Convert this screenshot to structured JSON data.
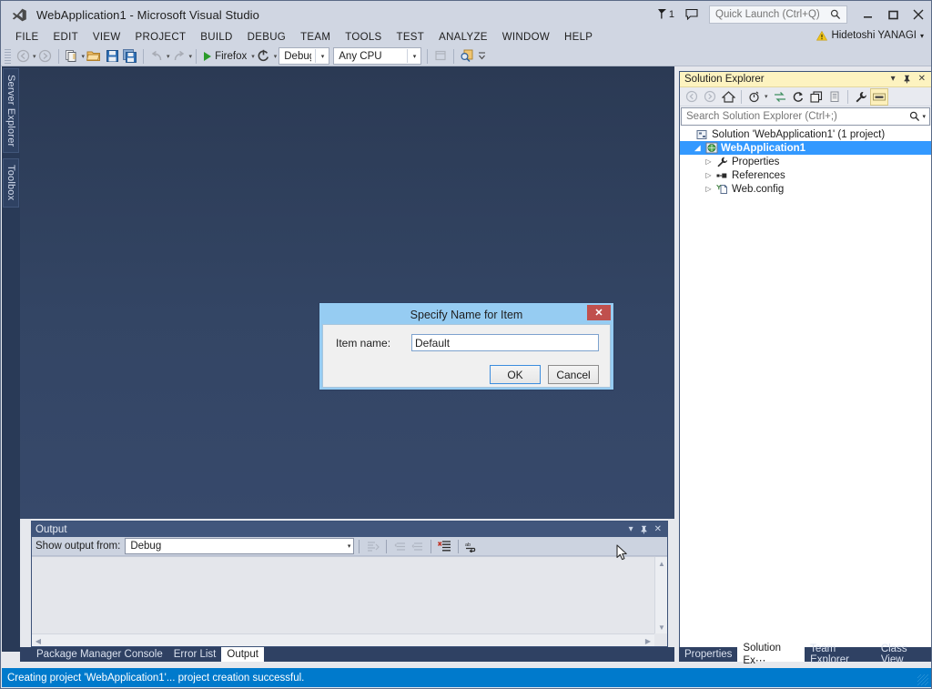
{
  "window": {
    "title": "WebApplication1 - Microsoft Visual Studio",
    "logo_icon": "visual-studio-logo-icon",
    "minimize_label": "–",
    "maximize_label": "❐",
    "close_label": "✕"
  },
  "titlebar": {
    "notification_icon": "notification-flag-icon",
    "notification_count": "1",
    "feedback_icon": "feedback-speech-bubble-icon",
    "quick_launch": {
      "placeholder": "Quick Launch (Ctrl+Q)",
      "value": "",
      "icon": "search-magnifier-icon"
    }
  },
  "menubar": {
    "items": [
      {
        "label": "FILE"
      },
      {
        "label": "EDIT"
      },
      {
        "label": "VIEW"
      },
      {
        "label": "PROJECT"
      },
      {
        "label": "BUILD"
      },
      {
        "label": "DEBUG"
      },
      {
        "label": "TEAM"
      },
      {
        "label": "TOOLS"
      },
      {
        "label": "TEST"
      },
      {
        "label": "ANALYZE"
      },
      {
        "label": "WINDOW"
      },
      {
        "label": "HELP"
      }
    ],
    "account": {
      "warning_icon": "warning-triangle-icon",
      "name": "Hidetoshi YANAGI",
      "caret": "▾"
    }
  },
  "toolbar": {
    "nav_back_icon": "navigate-back-icon",
    "nav_forward_icon": "navigate-forward-icon",
    "new_project_icon": "new-project-icon",
    "open_file_icon": "open-file-folder-icon",
    "save_icon": "save-icon",
    "save_all_icon": "save-all-icon",
    "undo_icon": "undo-arrow-icon",
    "redo_icon": "redo-arrow-icon",
    "start_icon": "start-debug-play-icon",
    "start_label": "Firefox",
    "refresh_icon": "refresh-circular-arrow-icon",
    "configuration": {
      "value": "Debug",
      "arrow": "▾"
    },
    "platform": {
      "value": "Any CPU",
      "arrow": "▾"
    },
    "window_icon": "new-window-icon",
    "find_icon": "find-in-files-icon",
    "overflow_icon": "toolbar-overflow-chevron-icon"
  },
  "leftdock": {
    "tabs": [
      {
        "label": "Server Explorer"
      },
      {
        "label": "Toolbox"
      }
    ]
  },
  "output_panel": {
    "title": "Output",
    "header_buttons": {
      "dropdown": "▾",
      "pin": "⤓",
      "close": "✕"
    },
    "show_output_from_label": "Show output from:",
    "source": {
      "value": "Debug",
      "arrow": "▾"
    },
    "toolbar_icons": [
      "find-message-icon",
      "clear-all-icon",
      "go-to-previous-icon",
      "go-to-next-icon",
      "toggle-word-wrap-icon"
    ],
    "content": ""
  },
  "bottom_tabs": {
    "items": [
      {
        "label": "Package Manager Console",
        "active": false
      },
      {
        "label": "Error List",
        "active": false
      },
      {
        "label": "Output",
        "active": true
      }
    ]
  },
  "solution_explorer": {
    "title": "Solution Explorer",
    "header_buttons": {
      "dropdown": "▾",
      "pin": "⤓",
      "close": "✕"
    },
    "toolbar_icons": [
      "back-navigate-icon",
      "forward-navigate-icon",
      "home-icon",
      "pending-changes-filter-icon",
      "sync-with-active-document-icon",
      "refresh-icon",
      "collapse-all-icon",
      "show-all-files-icon",
      "properties-wrench-icon",
      "preview-selected-items-icon"
    ],
    "search": {
      "placeholder": "Search Solution Explorer (Ctrl+;)",
      "value": "",
      "icon": "search-magnifier-icon",
      "caret": "▾"
    },
    "tree": [
      {
        "label": "Solution 'WebApplication1' (1 project)",
        "icon": "solution-icon",
        "indent": 0,
        "expander": "",
        "selected": false
      },
      {
        "label": "WebApplication1",
        "icon": "web-project-icon",
        "indent": 1,
        "expander": "◢",
        "selected": true
      },
      {
        "label": "Properties",
        "icon": "properties-wrench-icon",
        "indent": 2,
        "expander": "▷",
        "selected": false
      },
      {
        "label": "References",
        "icon": "references-icon",
        "indent": 2,
        "expander": "▷",
        "selected": false
      },
      {
        "label": "Web.config",
        "icon": "config-file-icon",
        "indent": 2,
        "expander": "▷",
        "selected": false
      }
    ]
  },
  "right_bottom_tabs": {
    "items": [
      {
        "label": "Properties",
        "active": false
      },
      {
        "label": "Solution Ex⋯",
        "active": true
      },
      {
        "label": "Team Explorer",
        "active": false
      },
      {
        "label": "Class View",
        "active": false
      }
    ]
  },
  "statusbar": {
    "text": "Creating project 'WebApplication1'... project creation successful.",
    "color": "#007acc"
  },
  "dialog": {
    "title": "Specify Name for Item",
    "close_label": "✕",
    "field_label": "Item name:",
    "field_value": "Default",
    "buttons": [
      {
        "label": "OK",
        "style": "default"
      },
      {
        "label": "Cancel",
        "style": "normal"
      }
    ]
  },
  "colors": {
    "accent_blue": "#007acc",
    "selection_blue": "#3399ff",
    "chrome": "#d0d6e2",
    "editor_bg_top": "#2b3a54",
    "editor_bg_bottom": "#37496b",
    "panel_header_yellow": "#fdf3c0",
    "panel_header_blue": "#41567c",
    "dialog_frame": "#96ccf2",
    "dialog_close_red": "#c0504d"
  }
}
